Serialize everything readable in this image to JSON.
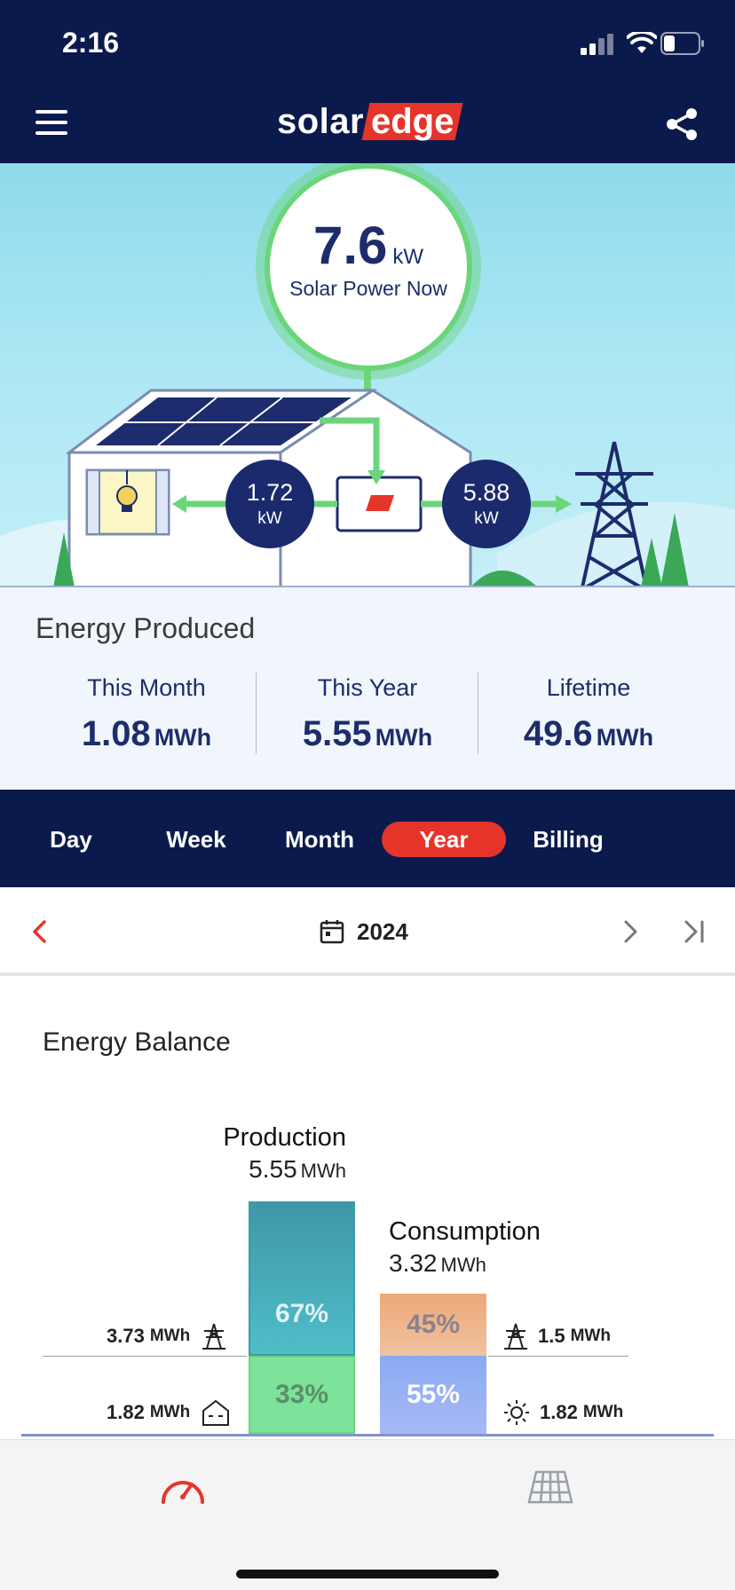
{
  "status_bar": {
    "time": "2:16"
  },
  "header": {
    "logo_part1": "solar",
    "logo_part2": "edge"
  },
  "hero": {
    "power_value": "7.6",
    "power_unit": "kW",
    "power_label": "Solar Power Now",
    "home_flow": {
      "value": "1.72",
      "unit": "kW"
    },
    "grid_flow": {
      "value": "5.88",
      "unit": "kW"
    }
  },
  "energy_produced": {
    "title": "Energy Produced",
    "stats": [
      {
        "label": "This Month",
        "value": "1.08",
        "unit": "MWh"
      },
      {
        "label": "This Year",
        "value": "5.55",
        "unit": "MWh"
      },
      {
        "label": "Lifetime",
        "value": "49.6",
        "unit": "MWh"
      }
    ]
  },
  "tabs": [
    {
      "label": "Day",
      "active": false
    },
    {
      "label": "Week",
      "active": false
    },
    {
      "label": "Month",
      "active": false
    },
    {
      "label": "Year",
      "active": true
    },
    {
      "label": "Billing",
      "active": false
    }
  ],
  "date_nav": {
    "label": "2024"
  },
  "energy_balance": {
    "title": "Energy Balance",
    "production": {
      "title": "Production",
      "value": "5.55",
      "unit": "MWh",
      "export_pct": "67%",
      "self_pct": "33%"
    },
    "consumption": {
      "title": "Consumption",
      "value": "3.32",
      "unit": "MWh",
      "import_pct": "45%",
      "self_pct": "55%"
    },
    "exported": {
      "value": "3.73",
      "unit": "MWh"
    },
    "self_consumed": {
      "value": "1.82",
      "unit": "MWh"
    },
    "imported": {
      "value": "1.5",
      "unit": "MWh"
    },
    "solar_consumed": {
      "value": "1.82",
      "unit": "MWh"
    }
  },
  "colors": {
    "navy": "#0b1a4c",
    "accent_red": "#e5352b",
    "export_teal": "#46a8b7",
    "self_green": "#7ee39a",
    "import_orange": "#eda777",
    "solar_blue": "#8aaaf2"
  }
}
